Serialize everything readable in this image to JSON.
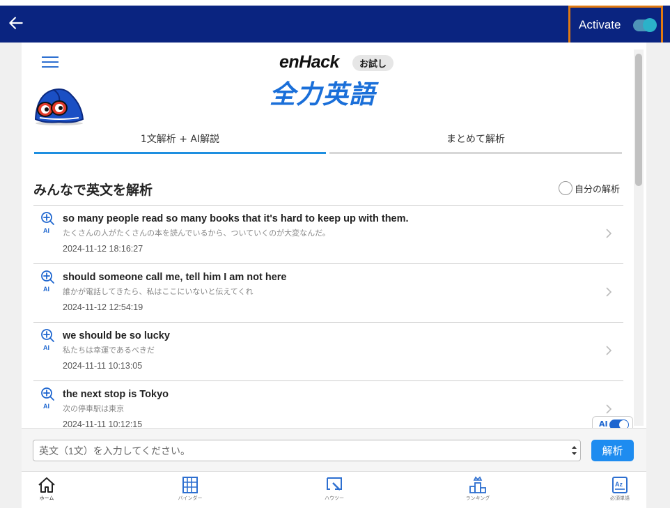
{
  "topbar": {
    "activate_label": "Activate",
    "activate_on": true,
    "back_icon": "arrow-left-icon"
  },
  "header": {
    "brand_en": "enHack",
    "trial_badge": "お試し",
    "brand_jp": "全力英語"
  },
  "tabs": [
    {
      "label": "1文解析 + AI解説",
      "active": true
    },
    {
      "label": "まとめて解析",
      "active": false
    }
  ],
  "section": {
    "title": "みんなで英文を解析",
    "mine_label": "自分の解析"
  },
  "items": [
    {
      "en": "so many people read so many books that it's hard to keep up with them.",
      "jp": "たくさんの人がたくさんの本を読んでいるから、ついていくのが大変なんだ。",
      "date": "2024-11-12 18:16:27"
    },
    {
      "en": "should someone call me, tell him I am not here",
      "jp": "誰かが電話してきたら、私はここにいないと伝えてくれ",
      "date": "2024-11-12 12:54:19"
    },
    {
      "en": "we should be so lucky",
      "jp": "私たちは幸運であるべきだ",
      "date": "2024-11-11 10:13:05"
    },
    {
      "en": "the next stop is Tokyo",
      "jp": "次の停車駅は東京",
      "date": "2024-11-11 10:12:15"
    }
  ],
  "ai_badge": "AI",
  "ai_toggle_label": "AI",
  "input": {
    "placeholder": "英文（1文）を入力してください。",
    "submit_label": "解析"
  },
  "nav": [
    {
      "label": "ホーム",
      "icon": "home-icon",
      "active": true
    },
    {
      "label": "バインダー",
      "icon": "binder-icon"
    },
    {
      "label": "ハウツー",
      "icon": "howto-icon"
    },
    {
      "label": "ランキング",
      "icon": "ranking-icon"
    },
    {
      "label": "必須単語",
      "icon": "vocabulary-icon"
    }
  ],
  "colors": {
    "topbar": "#0a2480",
    "highlight_border": "#e07a12",
    "accent": "#1e8cf0",
    "brand_blue": "#1a6fd9"
  }
}
